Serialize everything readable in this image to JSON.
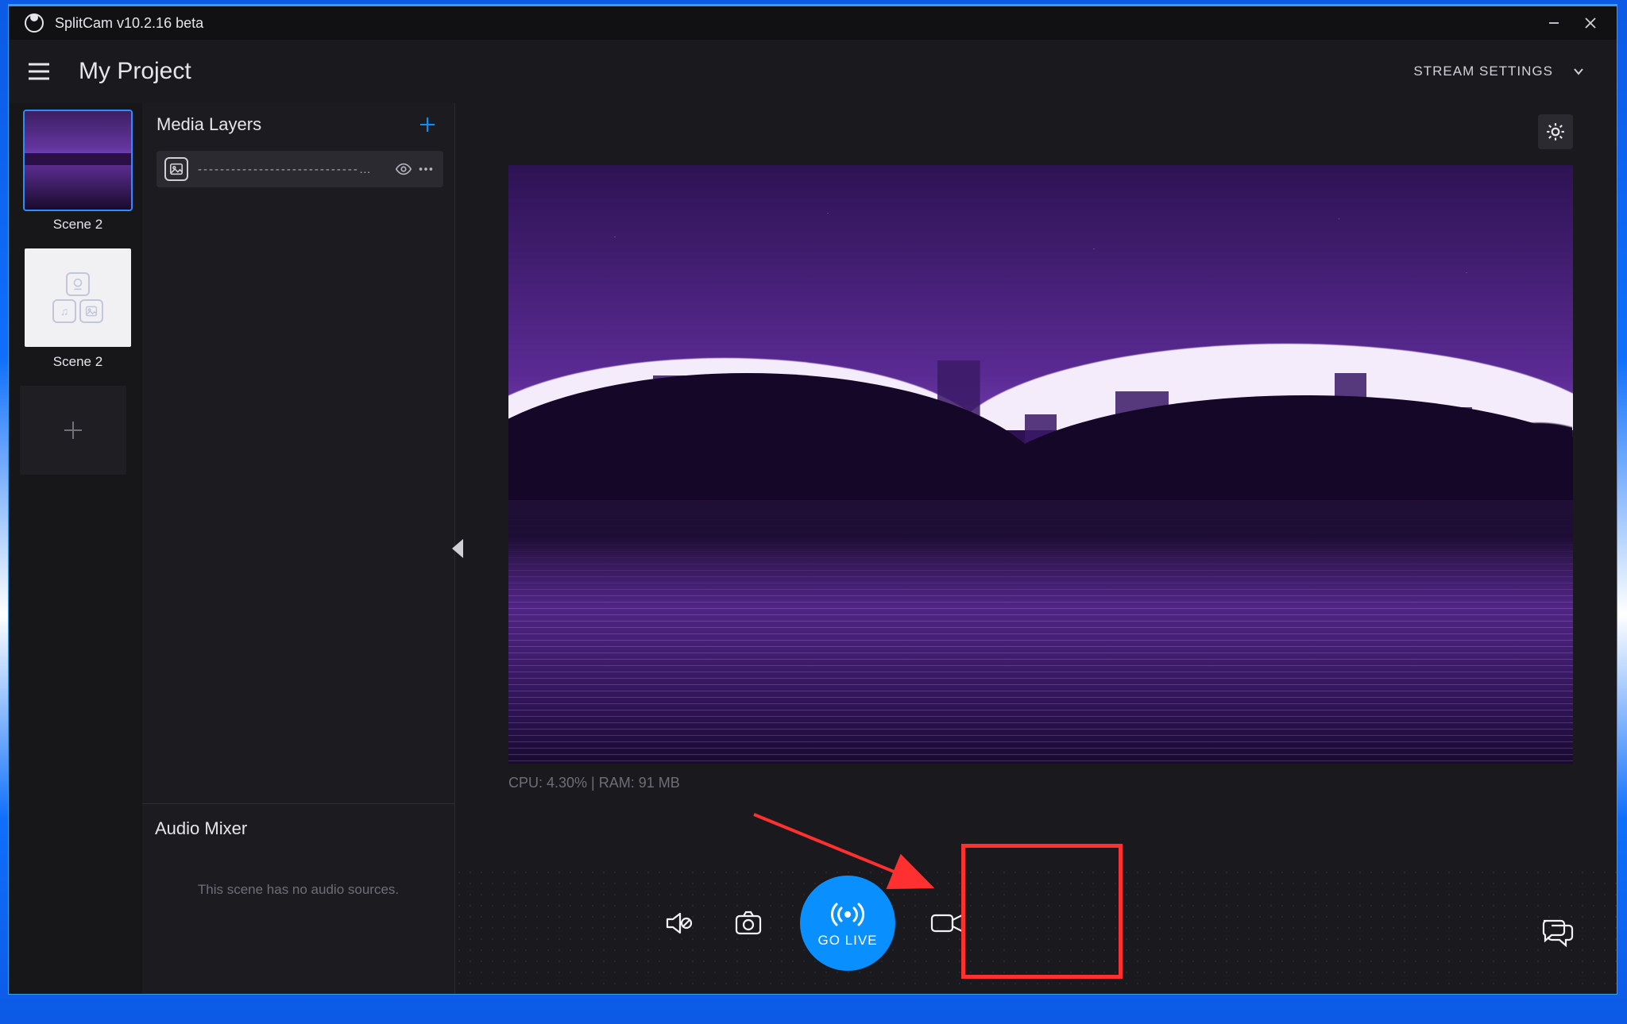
{
  "titlebar": {
    "title": "SplitCam v10.2.16 beta"
  },
  "header": {
    "project_title": "My Project",
    "stream_settings_label": "STREAM SETTINGS"
  },
  "scenes": [
    {
      "label": "Scene 2",
      "selected": true,
      "kind": "preview"
    },
    {
      "label": "Scene 2",
      "selected": false,
      "kind": "placeholder"
    }
  ],
  "layers_panel": {
    "title": "Media Layers",
    "items": [
      {
        "name": "-----------------------------…"
      }
    ]
  },
  "audio_mixer": {
    "title": "Audio Mixer",
    "empty_text": "This scene has no audio sources."
  },
  "stats": {
    "text": "CPU: 4.30% | RAM: 91 MB"
  },
  "toolbar": {
    "go_live_label": "GO LIVE"
  }
}
